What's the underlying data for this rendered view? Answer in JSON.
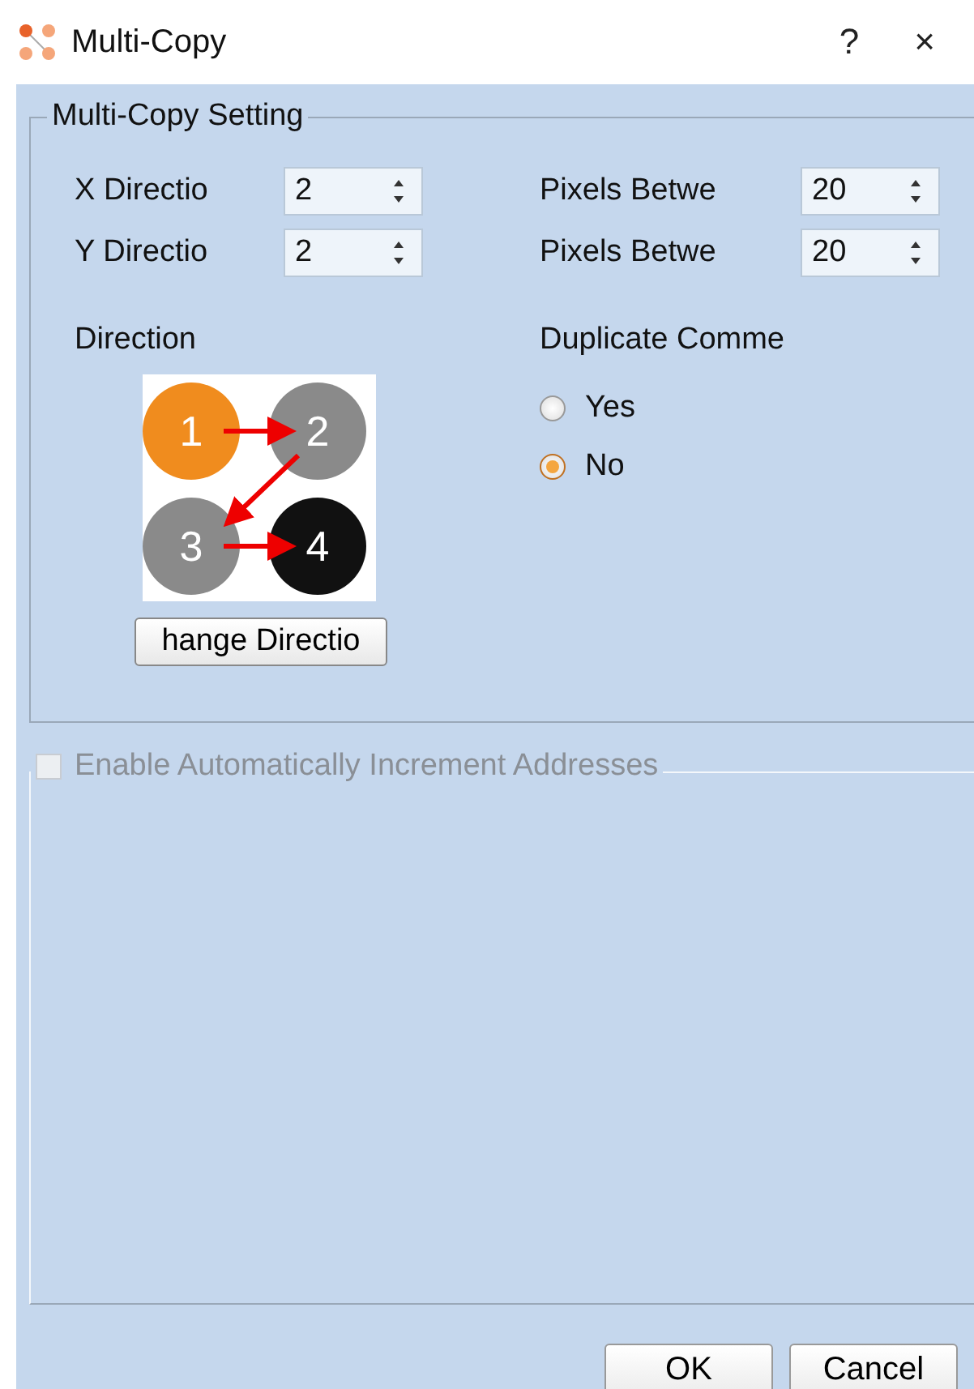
{
  "window": {
    "title": "Multi-Copy",
    "help": "?",
    "close": "×"
  },
  "setting_group": {
    "title": "Multi-Copy Setting",
    "fields": [
      {
        "label": "X Directio",
        "value": "2"
      },
      {
        "label": "Pixels Betwe",
        "value": "20"
      },
      {
        "label": "Y Directio",
        "value": "2"
      },
      {
        "label": "Pixels Betwe",
        "value": "20"
      }
    ],
    "direction": {
      "label": "Direction",
      "steps": [
        "1",
        "2",
        "3",
        "4"
      ],
      "button": "hange Directio"
    },
    "duplicate": {
      "label": "Duplicate Comme",
      "options": [
        {
          "label": "Yes",
          "selected": false
        },
        {
          "label": "No",
          "selected": true
        }
      ]
    }
  },
  "increment_group": {
    "title": "Enable Automatically Increment Addresses",
    "checked": false,
    "disabled": true
  },
  "buttons": [
    "OK",
    "Cancel"
  ]
}
